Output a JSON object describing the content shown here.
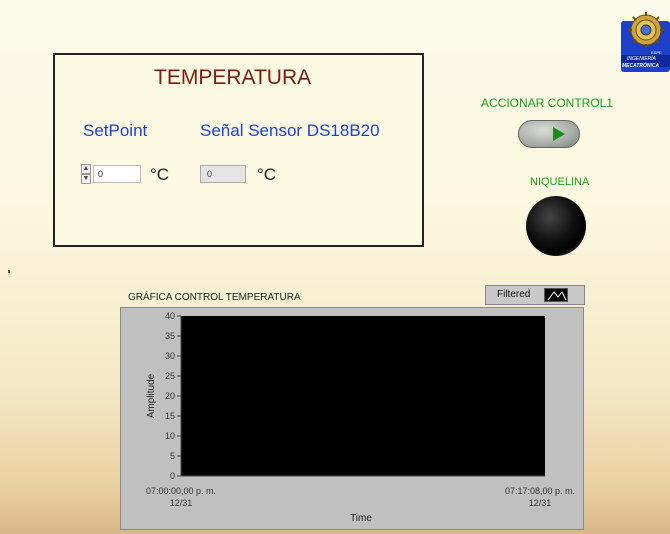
{
  "temperature_panel": {
    "title": "TEMPERATURA",
    "setpoint_label": "SetPoint",
    "sensor_label": "Señal Sensor DS18B20",
    "setpoint_value": "0",
    "sensor_value": "0",
    "unit": "°C"
  },
  "controls": {
    "control_label": "ACCIONAR CONTROL1",
    "led_label": "NIQUELINA"
  },
  "logo": {
    "text_top": "ESPE",
    "text_mid": "INGENIERÍA",
    "text_bottom": "MECATRÓNICA"
  },
  "chart": {
    "title": "GRÁFICA CONTROL TEMPERATURA",
    "legend_label": "Filtered"
  },
  "chart_data": {
    "type": "line",
    "title": "GRÁFICA CONTROL TEMPERATURA",
    "xlabel": "Time",
    "ylabel": "Amplitude",
    "ylim": [
      0,
      40
    ],
    "yticks": [
      0,
      5,
      10,
      15,
      20,
      25,
      30,
      35,
      40
    ],
    "x_start": {
      "time": "07:00:00,00 p. m.",
      "date": "12/31"
    },
    "x_end": {
      "time": "07:17:08,00 p. m.",
      "date": "12/31"
    },
    "series": [
      {
        "name": "Filtered",
        "values": []
      }
    ],
    "background": "#000000"
  }
}
